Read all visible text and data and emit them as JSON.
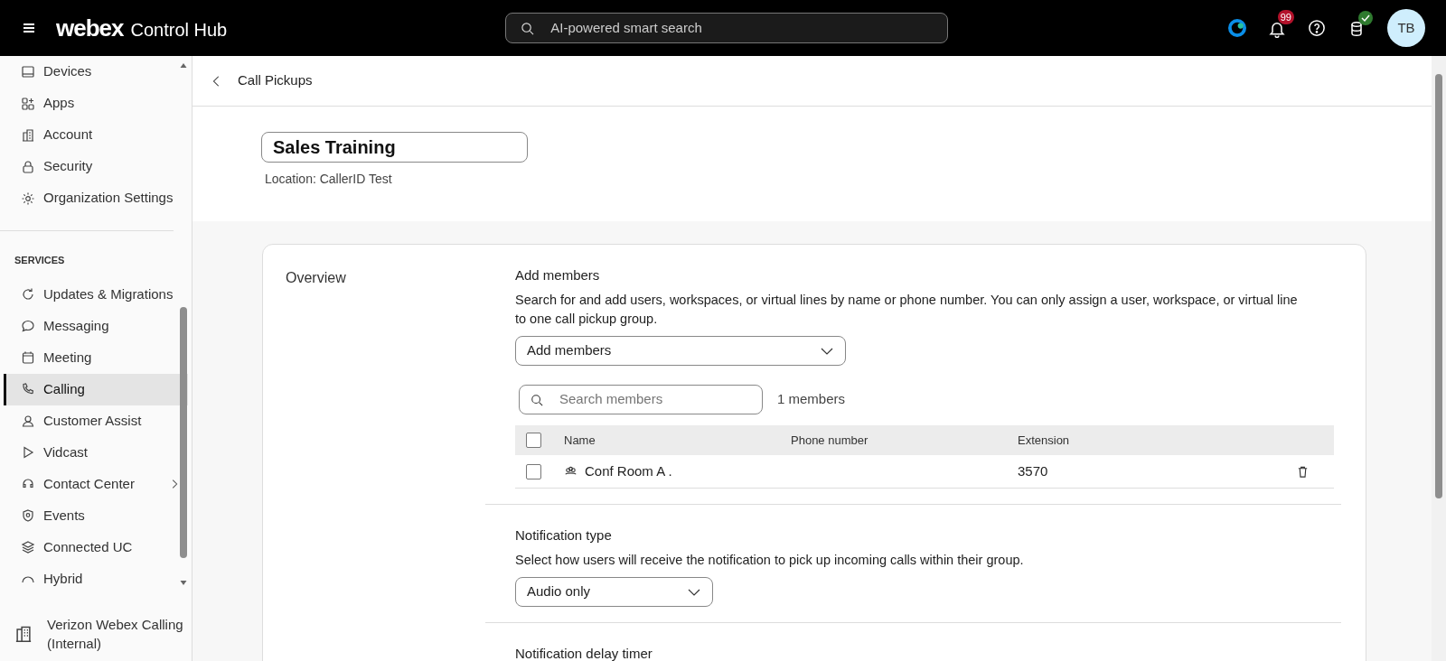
{
  "header": {
    "brand": "webex",
    "product": "Control Hub",
    "search": {
      "placeholder": "AI-powered smart search"
    },
    "notifications": "99",
    "avatar": "TB"
  },
  "sidebar": {
    "items": [
      {
        "label": "Devices",
        "selected": false,
        "has_submenu": false
      },
      {
        "label": "Apps",
        "selected": false,
        "has_submenu": false
      },
      {
        "label": "Account",
        "selected": false,
        "has_submenu": false
      },
      {
        "label": "Security",
        "selected": false,
        "has_submenu": false
      },
      {
        "label": "Organization Settings",
        "selected": false,
        "has_submenu": false
      }
    ],
    "services": {
      "title": "SERVICES",
      "items": [
        {
          "label": "Updates & Migrations",
          "selected": false,
          "has_submenu": false
        },
        {
          "label": "Messaging",
          "selected": false,
          "has_submenu": false
        },
        {
          "label": "Meeting",
          "selected": false,
          "has_submenu": false
        },
        {
          "label": "Calling",
          "selected": true,
          "has_submenu": false
        },
        {
          "label": "Customer Assist",
          "selected": false,
          "has_submenu": false
        },
        {
          "label": "Vidcast",
          "selected": false,
          "has_submenu": false
        },
        {
          "label": "Contact Center",
          "selected": false,
          "has_submenu": true
        },
        {
          "label": "Events",
          "selected": false,
          "has_submenu": false
        },
        {
          "label": "Connected UC",
          "selected": false,
          "has_submenu": false
        },
        {
          "label": "Hybrid",
          "selected": false,
          "has_submenu": false
        }
      ]
    },
    "organization": "Verizon Webex Calling (Internal)"
  },
  "breadcrumb": "Call Pickups",
  "title": {
    "value": "Sales Training"
  },
  "location": "Location: CallerID Test",
  "card": {
    "label": "Overview",
    "add_members": {
      "title": "Add members",
      "description": "Search for and add users, workspaces, or virtual lines by name or phone number. You can only assign a user, workspace, or virtual line to one call pickup group.",
      "dropdown": "Add members",
      "search": {
        "placeholder": "Search members"
      },
      "count": "1 members",
      "table": {
        "all_checked": false,
        "columns": [
          "Name",
          "Phone number",
          "Extension"
        ],
        "rows": [
          {
            "name": "Conf Room A .",
            "extension": "3570",
            "checked": false
          }
        ]
      }
    },
    "notification_type": {
      "title": "Notification type",
      "description": "Select how users will receive the notification to pick up incoming calls within their group.",
      "dropdown": "Audio only"
    },
    "notification_delay": {
      "title": "Notification delay timer"
    }
  }
}
